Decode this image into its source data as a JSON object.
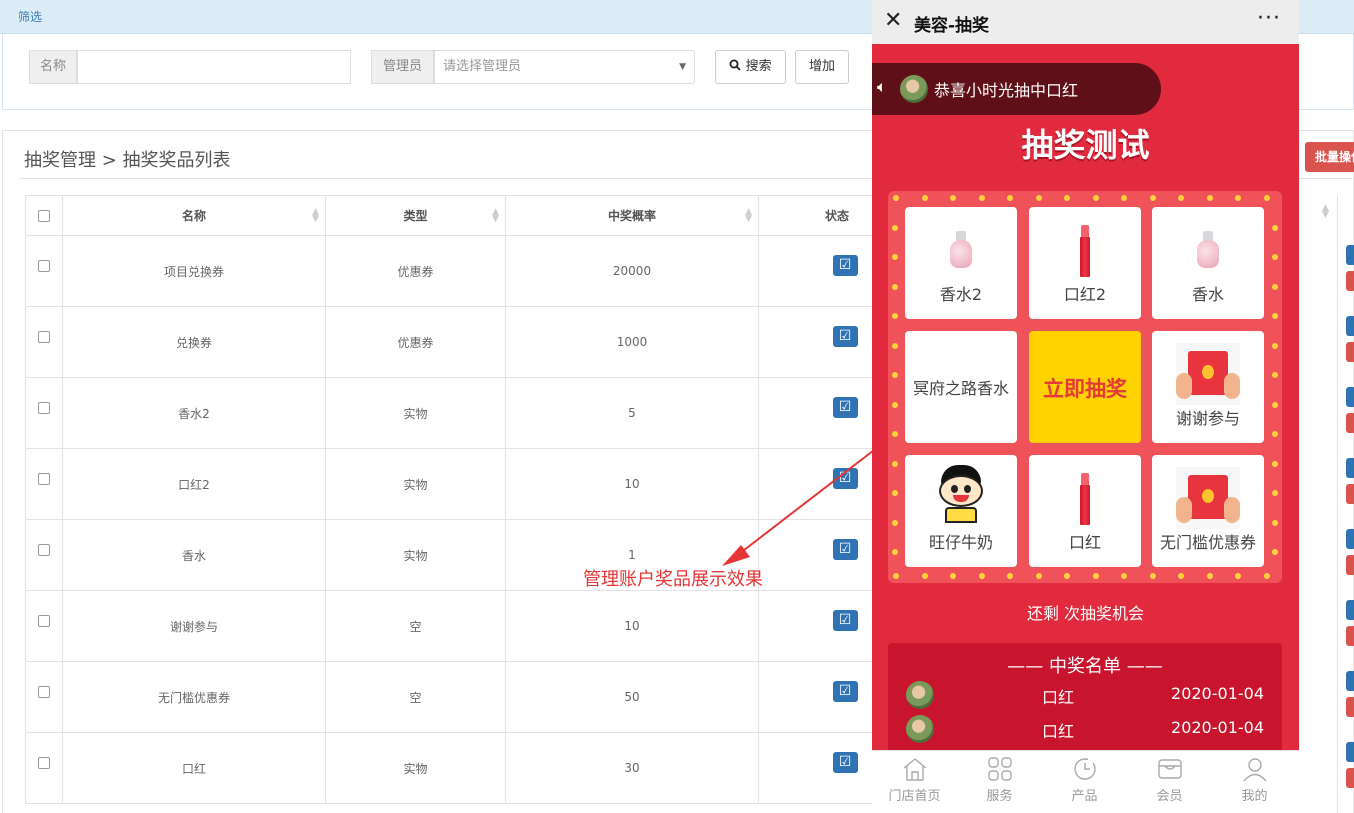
{
  "filter": {
    "title": "筛选",
    "name_label": "名称",
    "name_value": "",
    "admin_label": "管理员",
    "admin_placeholder": "请选择管理员",
    "search_label": "搜索",
    "add_label": "增加"
  },
  "breadcrumb": "抽奖管理 > 抽奖奖品列表",
  "bulk_label": "批量操作",
  "table": {
    "headers": [
      "名称",
      "类型",
      "中奖概率",
      "状态"
    ],
    "rows": [
      {
        "name": "项目兑换券",
        "type": "优惠券",
        "prob": "20000"
      },
      {
        "name": "兑换券",
        "type": "优惠券",
        "prob": "1000"
      },
      {
        "name": "香水2",
        "type": "实物",
        "prob": "5"
      },
      {
        "name": "口红2",
        "type": "实物",
        "prob": "10"
      },
      {
        "name": "香水",
        "type": "实物",
        "prob": "1"
      },
      {
        "name": "谢谢参与",
        "type": "空",
        "prob": "10"
      },
      {
        "name": "无门槛优惠券",
        "type": "空",
        "prob": "50"
      },
      {
        "name": "口红",
        "type": "实物",
        "prob": "30"
      }
    ]
  },
  "annotation": "管理账户奖品展示效果",
  "phone": {
    "title": "美容-抽奖",
    "notice": "恭喜小时光抽中口红",
    "lottery_title": "抽奖测试",
    "cells": [
      "香水2",
      "口红2",
      "香水",
      "冥府之路香水",
      "立即抽奖",
      "谢谢参与",
      "旺仔牛奶",
      "口红",
      "无门槛优惠券"
    ],
    "remain": "还剩 次抽奖机会",
    "winners_title": "—— 中奖名单 ——",
    "winners": [
      {
        "prize": "口红",
        "date": "2020-01-04"
      },
      {
        "prize": "口红",
        "date": "2020-01-04"
      }
    ],
    "tabs": [
      "门店首页",
      "服务",
      "产品",
      "会员",
      "我的"
    ]
  },
  "colors": {
    "accent_blue": "#2f73b5",
    "phone_red": "#e12a3d",
    "annotation_red": "#e73434",
    "draw_yellow": "#ffd200"
  }
}
